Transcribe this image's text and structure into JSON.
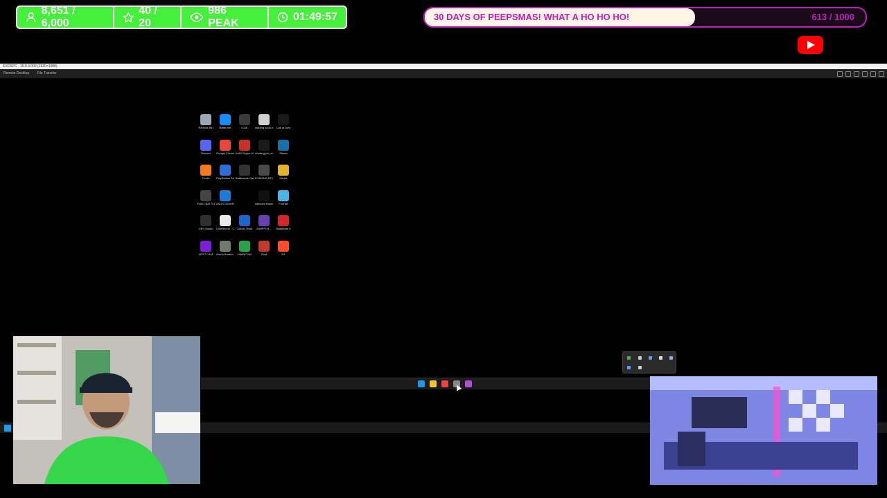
{
  "overlay": {
    "stats": [
      {
        "icon": "person-icon",
        "value": "8,651 / 6,000"
      },
      {
        "icon": "star-icon",
        "value": "40 / 20"
      },
      {
        "icon": "eye-icon",
        "value": "986 PEAK"
      },
      {
        "icon": "clock-icon",
        "value": "01:49:57"
      }
    ],
    "goal": {
      "title": "30 DAYS OF PEEPSMAS! WHAT A HO HO HO!",
      "count": "613 / 1000",
      "progress": 0.613
    },
    "youtube_icon": "youtube-icon",
    "colors": {
      "stats_bg": "#45f03a",
      "goal_accent": "#c21cc0",
      "goal_fill": "#fff4e6"
    }
  },
  "remote_window": {
    "title": "EXCSPC - 10.0.0.000 (1920×1080)",
    "tabs": [
      "Remote Desktop",
      "File Transfer"
    ]
  },
  "desktop_icons": [
    {
      "label": "Recycle Bin",
      "color": "#9aa7b5"
    },
    {
      "label": "Battle.net",
      "color": "#148eff"
    },
    {
      "label": "iCUE",
      "color": "#3a3a3a"
    },
    {
      "label": "starting soon.mp4",
      "color": "#d0d0d0"
    },
    {
      "label": "Call of Duty",
      "color": "#1a1a1a"
    },
    {
      "label": "Discord",
      "color": "#5865f2"
    },
    {
      "label": "Google Chrome",
      "color": "#e8453c"
    },
    {
      "label": "AMD Ryzen Master",
      "color": "#c8312a"
    },
    {
      "label": "chatting pic.png",
      "color": "#1a1a1a"
    },
    {
      "label": "Steam",
      "color": "#1b6fa8"
    },
    {
      "label": "FiveM",
      "color": "#f47b20"
    },
    {
      "label": "PlayStation Accessories",
      "color": "#2c6fd6"
    },
    {
      "label": "Battlestate Games L...",
      "color": "#333333"
    },
    {
      "label": "LOADING BF.mp4",
      "color": "#4a4a4a"
    },
    {
      "label": "Medal",
      "color": "#e7b22b"
    },
    {
      "label": "PUBG BATTLEGR...",
      "color": "#444444"
    },
    {
      "label": "ASUS DriverHub",
      "color": "#1a7bd8"
    },
    {
      "label": "",
      "color": "#000000"
    },
    {
      "label": "webcam frame.png",
      "color": "#111111"
    },
    {
      "label": "Fortnite",
      "color": "#48b4e8"
    },
    {
      "label": "OBS Studio",
      "color": "#302e31"
    },
    {
      "label": "UserBench - Copy",
      "color": "#e9e9e9"
    },
    {
      "label": "SAMA_Multi",
      "color": "#1f63c9"
    },
    {
      "label": "WARPS B...",
      "color": "#6b3fb0"
    },
    {
      "label": "Battlefield 6",
      "color": "#d2262b"
    },
    {
      "label": "NZXT CAM",
      "color": "#7e1fd6"
    },
    {
      "label": "Arena Breako...",
      "color": "#6f7a6a"
    },
    {
      "label": "HWiNFO64",
      "color": "#27a34a"
    },
    {
      "label": "Rust",
      "color": "#c0392b"
    },
    {
      "label": "EA",
      "color": "#ff4c2b"
    }
  ],
  "remote_taskbar_icons": [
    {
      "name": "start-icon",
      "color": "#1e9be8"
    },
    {
      "name": "folder-icon",
      "color": "#f2c335"
    },
    {
      "name": "chrome-icon",
      "color": "#e8453c"
    },
    {
      "name": "search-icon",
      "color": "#888888"
    },
    {
      "name": "app-icon",
      "color": "#b04fd8"
    }
  ],
  "webcams": {
    "left": "streamer-webcam",
    "right": "room-camera"
  }
}
